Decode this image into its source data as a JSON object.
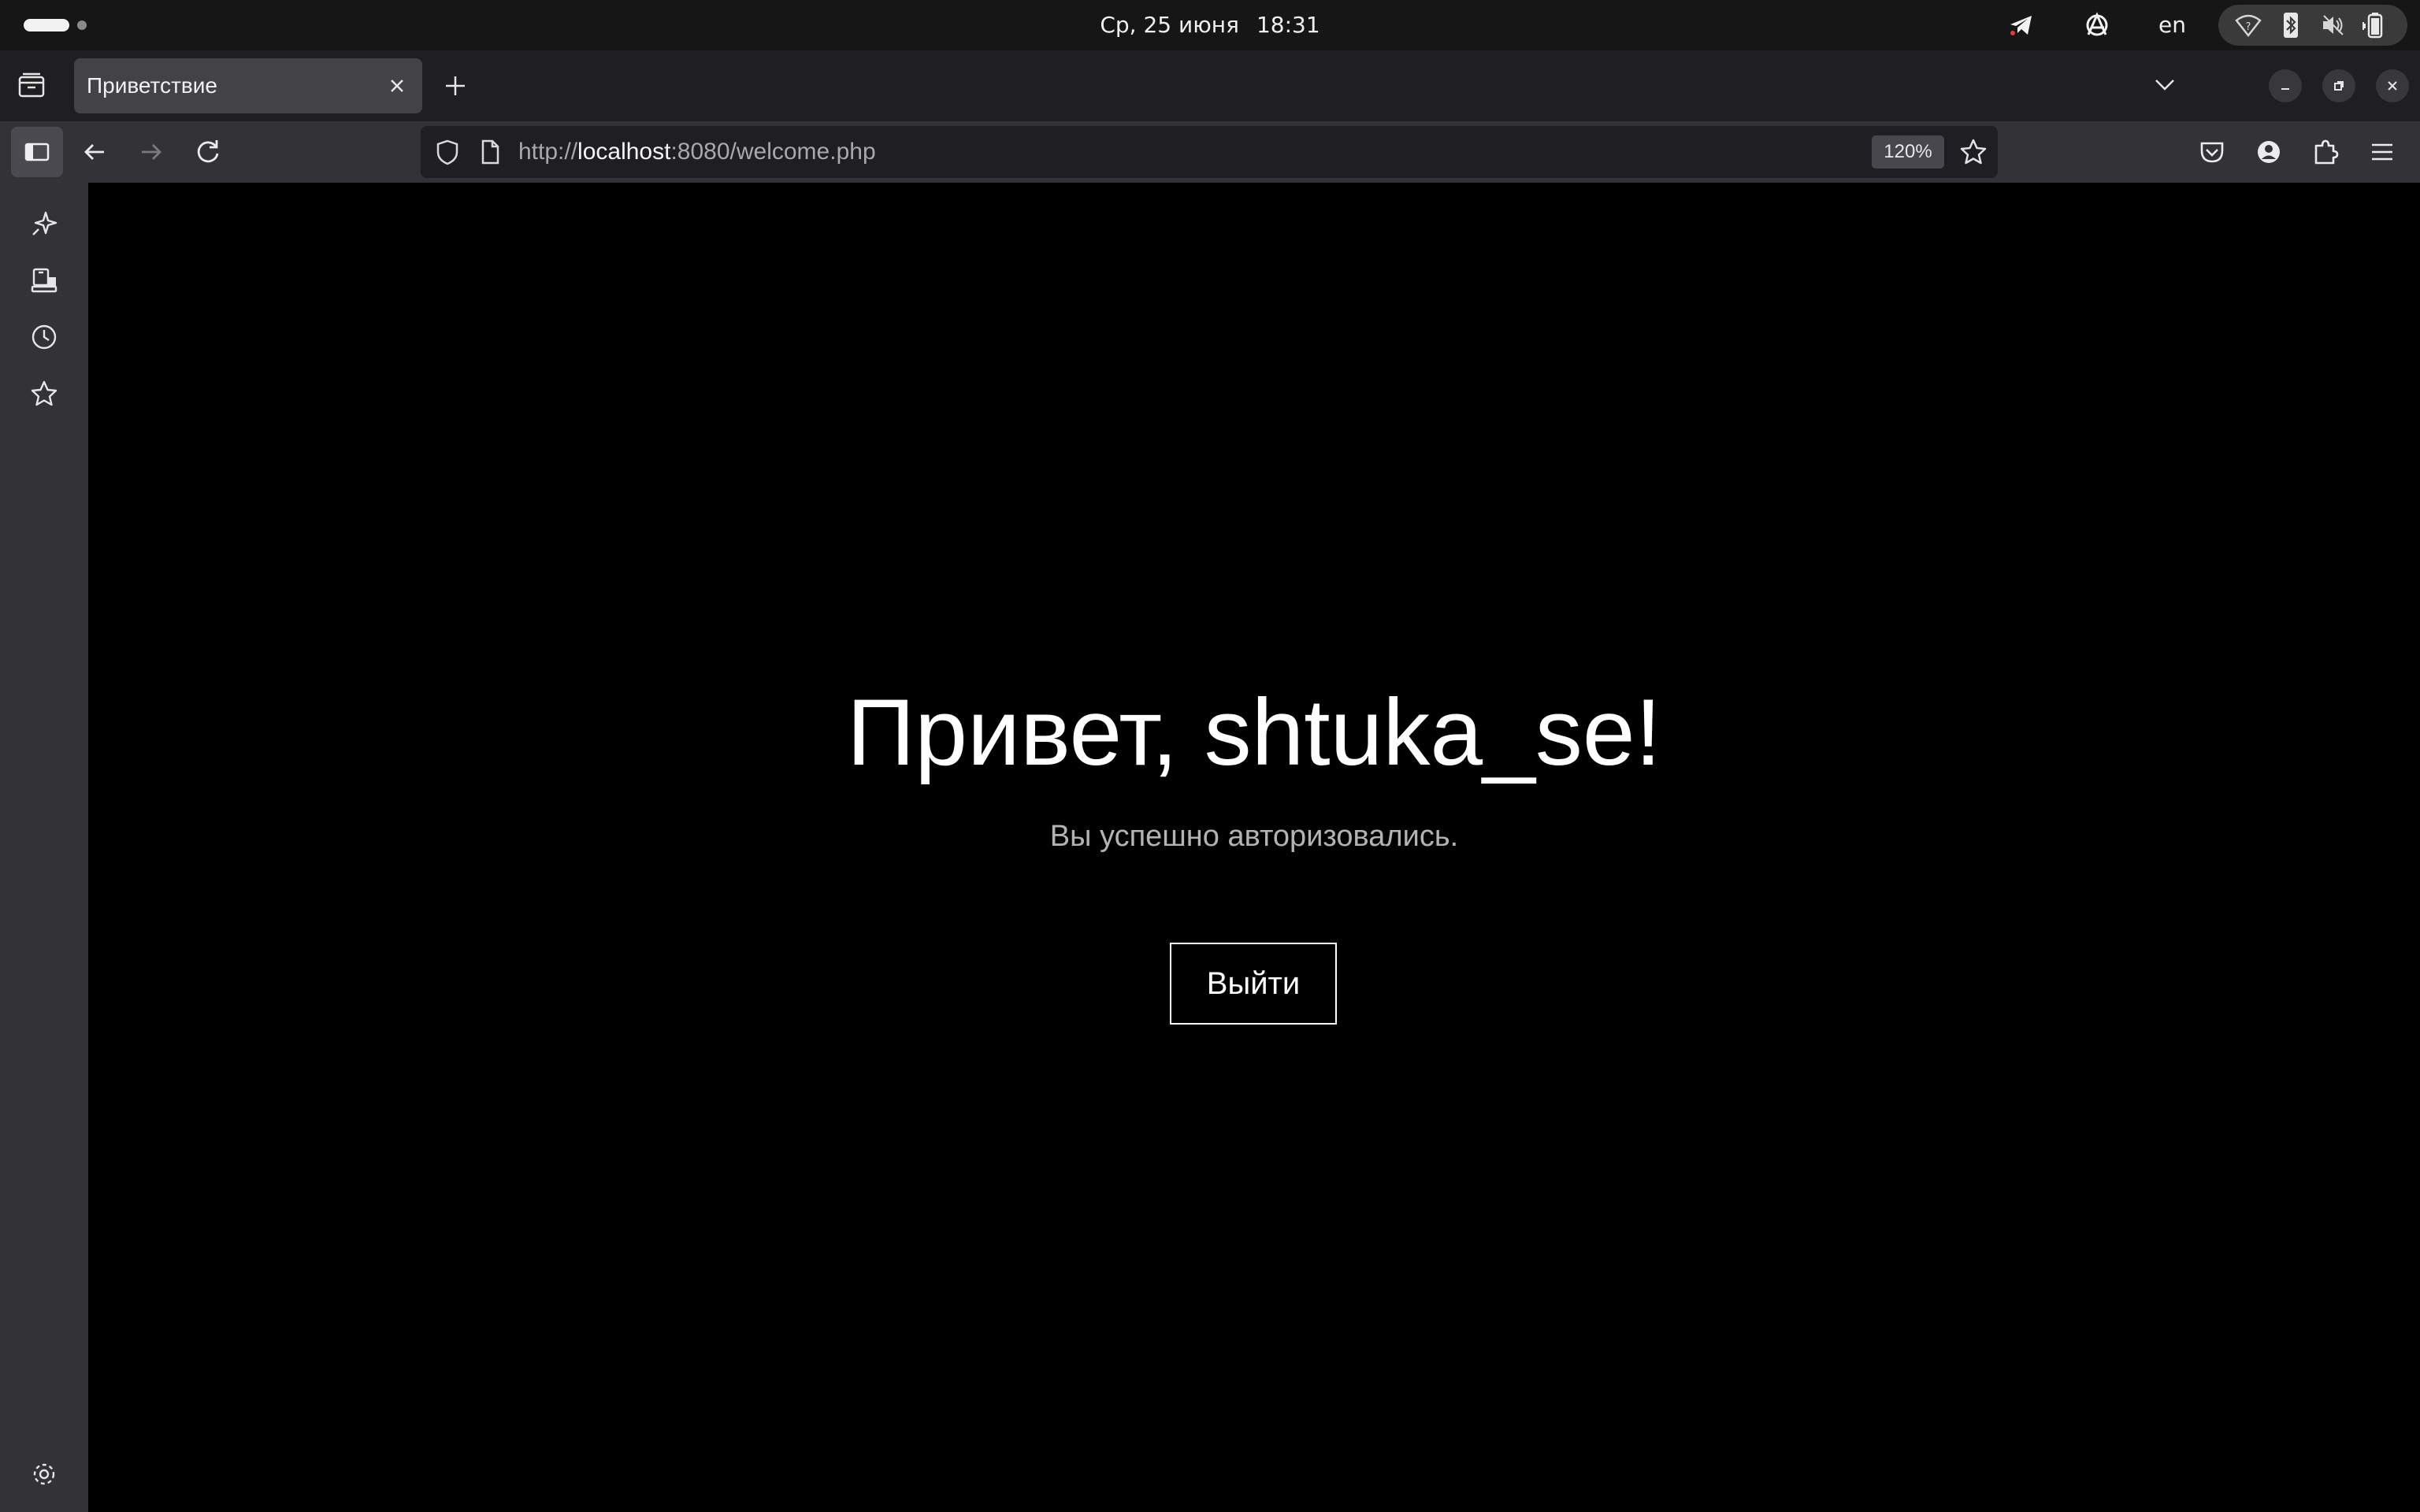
{
  "system": {
    "date": "Ср, 25 июня",
    "time": "18:31",
    "language": "en",
    "tray_icons": [
      "telegram-icon",
      "anarchy-icon",
      "wifi-icon",
      "bluetooth-icon",
      "volume-icon",
      "battery-icon"
    ]
  },
  "browser": {
    "tab": {
      "title": "Приветствие"
    },
    "url": {
      "scheme": "http://",
      "host": "localhost",
      "rest": ":8080/welcome.php"
    },
    "zoom": "120%",
    "sidebar_tools": [
      "ai-chat-icon",
      "synced-tabs-icon",
      "history-icon",
      "bookmarks-icon",
      "settings-icon"
    ],
    "colors": {
      "toolbar": "#333236",
      "tabstrip": "#1f1e21",
      "active_tab": "#434247"
    }
  },
  "page": {
    "greeting": "Привет, shtuka_se!",
    "subtitle": "Вы успешно авторизовались.",
    "logout_label": "Выйти",
    "colors": {
      "background": "#000000",
      "text": "#ffffff",
      "muted": "#b3b3b3"
    }
  }
}
